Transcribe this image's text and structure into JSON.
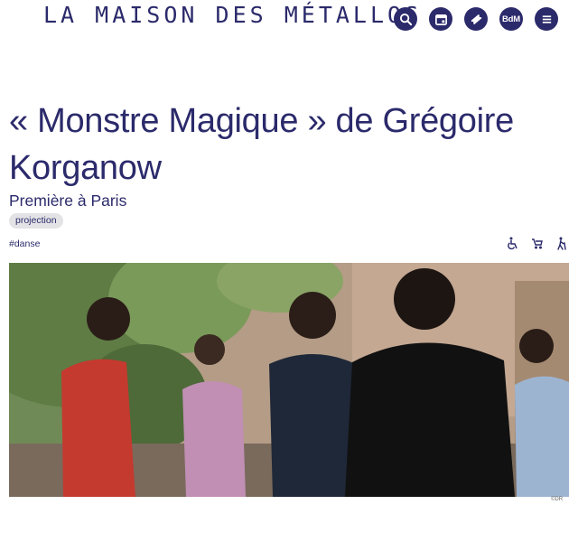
{
  "header": {
    "logo_text": "LA MAISON DES MÉTALLOS",
    "icons": [
      "search-icon",
      "calendar-icon",
      "ticket-icon",
      "bdm-logo",
      "menu-icon"
    ],
    "bdm_label": "BdM",
    "accent_color": "#2b2a6b"
  },
  "event": {
    "title": "« Monstre Magique » de Grégoire Korganow",
    "subtitle": "Première à Paris",
    "tag": "projection",
    "hashtag": "#danse",
    "accessibility_icons": [
      "wheelchair-icon",
      "stroller-icon",
      "senior-walking-icon"
    ],
    "image_credit": "©DR"
  }
}
